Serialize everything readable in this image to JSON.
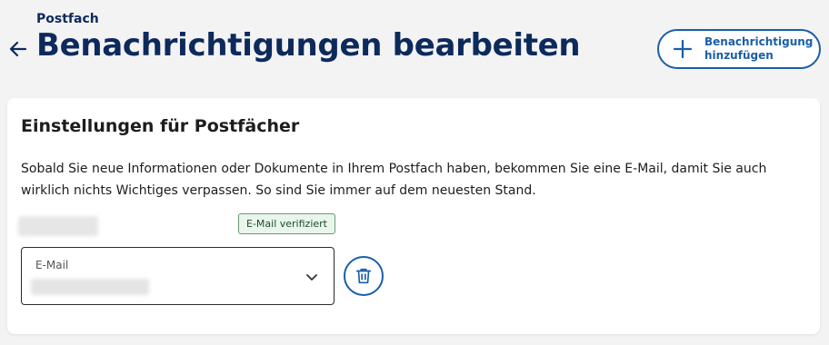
{
  "header": {
    "breadcrumb": "Postfach",
    "title": "Benachrichtigungen bearbeiten",
    "back_icon": "arrow-left-icon",
    "add_button_label": "Benachrichtigung\nhinzufügen",
    "add_icon": "plus-icon"
  },
  "card": {
    "title": "Einstellungen für Postfächer",
    "description": "Sobald Sie neue Informationen oder Dokumente in Ihrem Postfach haben, bekommen Sie eine E-Mail, damit Sie auch wirklich nichts Wichtiges verpassen. So sind Sie immer auf dem neuesten Stand.",
    "badge": "E-Mail verifiziert",
    "email_field": {
      "label": "E-Mail",
      "value": ""
    },
    "chevron_icon": "chevron-down-icon",
    "delete_icon": "trash-icon"
  },
  "colors": {
    "title": "#0d2a5c",
    "accent": "#1a5ea8",
    "badge_bg": "#eaf5ec",
    "badge_border": "#6a9c77",
    "page_bg": "#f3f3f4"
  }
}
